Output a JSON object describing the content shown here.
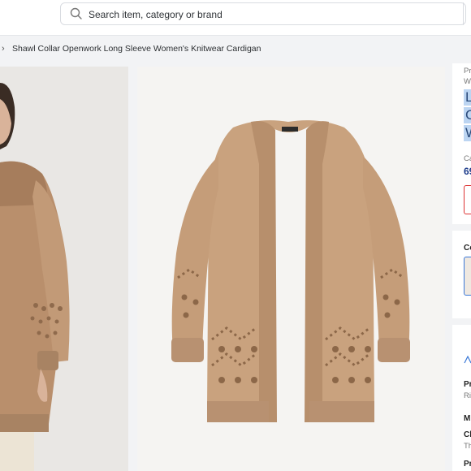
{
  "search": {
    "placeholder": "Search item, category or brand"
  },
  "breadcrumb": {
    "separator": "›",
    "current": "Shawl Collar Openwork Long Sleeve Women's Knitwear Cardigan"
  },
  "gallery": {
    "thumbnail_alt": "Model wearing beige knit cardigan, back view",
    "main_alt": "Beige openwork knit cardigan product photo"
  },
  "product_panel": {
    "brand_line_1": "Pr",
    "brand_line_2": "W",
    "title_line_1": "L",
    "title_line_2": "C",
    "title_line_3": "W",
    "cart_label": "Ca",
    "price": "69",
    "color_label": "Co",
    "info_label_1": "Pr",
    "info_value_1": "Ri",
    "info_label_2": "M",
    "info_label_3": "Cl",
    "info_value_3": "Th",
    "info_label_4": "Pr"
  },
  "colors": {
    "accent": "#3a78d8",
    "price": "#1a3a8a",
    "title_highlight": "#bcd5f2",
    "cardigan": "#c9a27e"
  }
}
